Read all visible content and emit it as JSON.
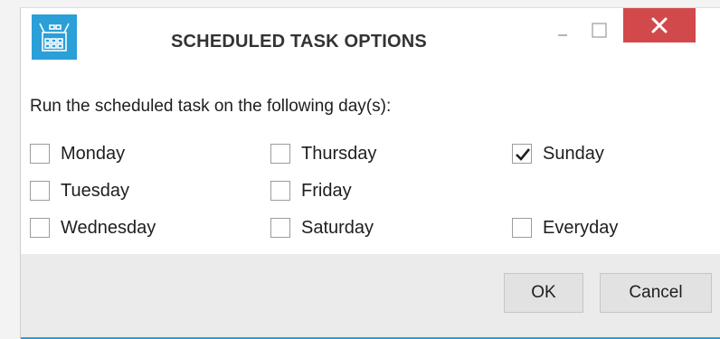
{
  "window": {
    "title": "SCHEDULED TASK OPTIONS",
    "app_icon": "scheduler-icon",
    "accent_color": "#2a9fd8",
    "close_color": "#d2494b"
  },
  "prompt": "Run the scheduled task on the following day(s):",
  "days": {
    "monday": {
      "label": "Monday",
      "checked": false
    },
    "tuesday": {
      "label": "Tuesday",
      "checked": false
    },
    "wednesday": {
      "label": "Wednesday",
      "checked": false
    },
    "thursday": {
      "label": "Thursday",
      "checked": false
    },
    "friday": {
      "label": "Friday",
      "checked": false
    },
    "saturday": {
      "label": "Saturday",
      "checked": false
    },
    "sunday": {
      "label": "Sunday",
      "checked": true
    },
    "everyday": {
      "label": "Everyday",
      "checked": false
    }
  },
  "buttons": {
    "ok": "OK",
    "cancel": "Cancel"
  }
}
